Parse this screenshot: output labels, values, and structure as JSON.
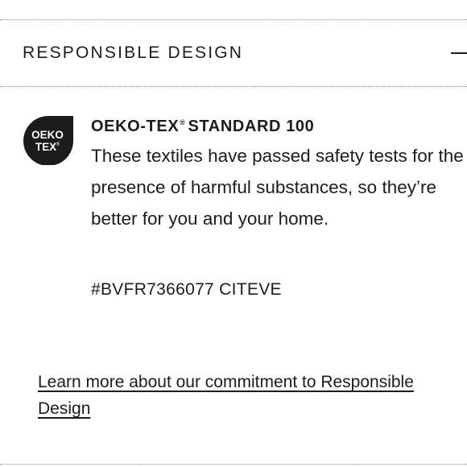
{
  "section": {
    "title": "RESPONSIBLE DESIGN",
    "toggle_icon": "minus-icon"
  },
  "certification": {
    "badge": {
      "icon": "oeko-tex-logo",
      "line1": "OEKO",
      "line2": "TEX",
      "mark": "®",
      "bg_color": "#1c1c1c"
    },
    "title_main": "OEKO-TEX",
    "title_mark": "®",
    "title_rest": "STANDARD 100",
    "description": "These textiles have passed safety tests for the presence of harmful substances, so they’re better for you and your home.",
    "code": "#BVFR7366077 CITEVE"
  },
  "link": {
    "text": "Learn more about our commitment to Responsible Design"
  }
}
